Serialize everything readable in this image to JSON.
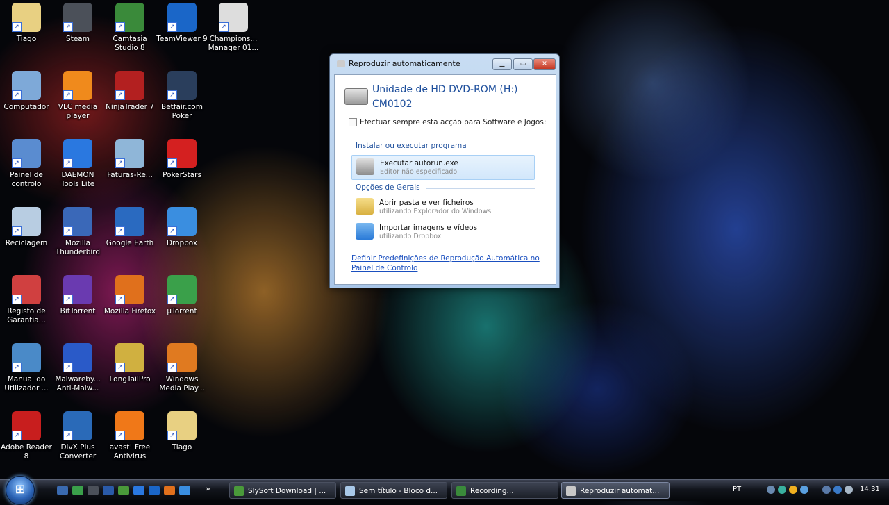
{
  "desktop_icons": [
    {
      "label": "Tiago",
      "name": "tiago-folder-icon",
      "color": "#e8d082"
    },
    {
      "label": "Steam",
      "name": "steam-icon",
      "color": "#4b5059"
    },
    {
      "label": "Camtasia Studio 8",
      "name": "camtasia-icon",
      "color": "#3a8a3a"
    },
    {
      "label": "TeamViewer 9",
      "name": "teamviewer-icon",
      "color": "#1a66c8"
    },
    {
      "label": "Champions... Manager 01...",
      "name": "champions-manager-icon",
      "color": "#dddddd"
    },
    {
      "label": "Computador",
      "name": "computer-icon",
      "color": "#7ea9d8"
    },
    {
      "label": "VLC media player",
      "name": "vlc-icon",
      "color": "#f08a1c"
    },
    {
      "label": "NinjaTrader 7",
      "name": "ninjatrader-icon",
      "color": "#b32020"
    },
    {
      "label": "Betfair.com Poker",
      "name": "betfair-poker-icon",
      "color": "#2a3e5c"
    },
    {
      "label": "Painel de controlo",
      "name": "control-panel-icon",
      "color": "#5a8cd0"
    },
    {
      "label": "DAEMON Tools Lite",
      "name": "daemon-tools-icon",
      "color": "#2a78e0"
    },
    {
      "label": "Faturas-Re...",
      "name": "faturas-icon",
      "color": "#8fb6d8"
    },
    {
      "label": "PokerStars",
      "name": "pokerstars-icon",
      "color": "#d42020"
    },
    {
      "label": "Reciclagem",
      "name": "recycle-bin-icon",
      "color": "#b8cde2"
    },
    {
      "label": "Mozilla Thunderbird",
      "name": "thunderbird-icon",
      "color": "#3a68b8"
    },
    {
      "label": "Google Earth",
      "name": "google-earth-icon",
      "color": "#2a6ac0"
    },
    {
      "label": "Dropbox",
      "name": "dropbox-icon",
      "color": "#3a8ee0"
    },
    {
      "label": "Registo de Garantia...",
      "name": "warranty-icon",
      "color": "#d04040"
    },
    {
      "label": "BitTorrent",
      "name": "bittorrent-icon",
      "color": "#6a3ab0"
    },
    {
      "label": "Mozilla Firefox",
      "name": "firefox-icon",
      "color": "#e0701c"
    },
    {
      "label": "µTorrent",
      "name": "utorrent-icon",
      "color": "#3aa04a"
    },
    {
      "label": "Manual do Utilizador ...",
      "name": "manual-icon",
      "color": "#4a8ac8"
    },
    {
      "label": "Malwareby... Anti-Malw...",
      "name": "malwarebytes-icon",
      "color": "#2a5ac8"
    },
    {
      "label": "LongTailPro",
      "name": "longtailpro-icon",
      "color": "#d0b040"
    },
    {
      "label": "Windows Media Play...",
      "name": "media-player-icon",
      "color": "#e07a20"
    },
    {
      "label": "Adobe Reader 8",
      "name": "adobe-reader-icon",
      "color": "#c81e1e"
    },
    {
      "label": "DivX Plus Converter",
      "name": "divx-converter-icon",
      "color": "#2a6ab8"
    },
    {
      "label": "avast! Free Antivirus",
      "name": "avast-icon",
      "color": "#f07818"
    },
    {
      "label": "Tiago",
      "name": "tiago-folder-2-icon",
      "color": "#e8d082"
    }
  ],
  "dialog": {
    "title": "Reproduzir automaticamente",
    "min": "▁",
    "max": "▭",
    "close": "✕",
    "drive_title": "Unidade de HD DVD-ROM (H:) CM0102",
    "checkbox_label": "Efectuar sempre esta acção para Software e Jogos:",
    "section1": "Instalar ou executar programa",
    "option1_main": "Executar autorun.exe",
    "option1_sub": "Editor não especificado",
    "section2": "Opções de Gerais",
    "option2_main": "Abrir pasta e ver ficheiros",
    "option2_sub": "utilizando Explorador do Windows",
    "option3_main": "Importar imagens e vídeos",
    "option3_sub": "utilizando Dropbox",
    "link": "Definir Predefinições de Reprodução Automática no Painel de Controlo"
  },
  "taskbar": {
    "start_glyph": "⊞",
    "buttons": [
      {
        "label": "SlySoft Download | ...",
        "icon": "chrome-icon",
        "color": "#4a9a3a"
      },
      {
        "label": "Sem título - Bloco d...",
        "icon": "notepad-icon",
        "color": "#a8c8e8"
      },
      {
        "label": "Recording...",
        "icon": "camtasia-recorder-icon",
        "color": "#3a8a3a"
      },
      {
        "label": "Reproduzir automat...",
        "icon": "autoplay-icon",
        "color": "#c8c8c8"
      }
    ],
    "language": "PT",
    "time": "14:31",
    "overflow": "»"
  }
}
